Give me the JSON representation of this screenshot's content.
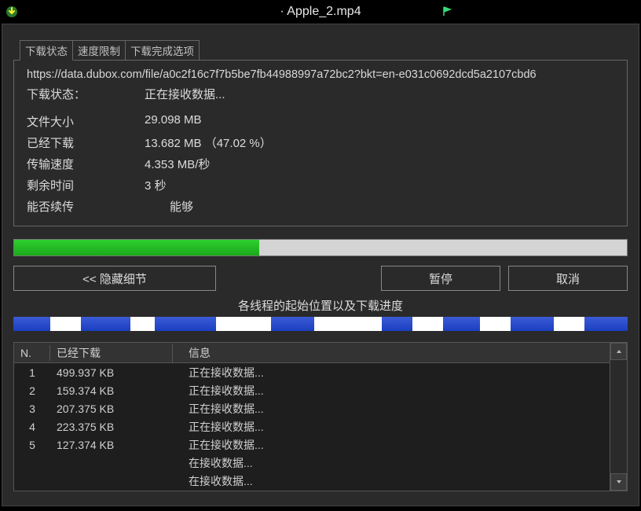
{
  "titlebar": {
    "title": "· Apple_2.mp4"
  },
  "tabs": {
    "status": "下载状态",
    "speed": "速度限制",
    "complete": "下载完成选项"
  },
  "status": {
    "url": "https://data.dubox.com/file/a0c2f16c7f7b5be7fb44988997a72bc2?bkt=en-e031c0692dcd5a2107cbd6",
    "label_state": "下载状态：",
    "value_state": "正在接收数据...",
    "label_size": "文件大小",
    "value_size": "29.098  MB",
    "label_downloaded": "已经下载",
    "value_downloaded": "13.682  MB （47.02 %）",
    "label_speed": "传输速度",
    "value_speed": "4.353  MB/秒",
    "label_remain": "剩余时间",
    "value_remain": "3 秒",
    "label_resume": "能否续传",
    "value_resume": "能够"
  },
  "progress": {
    "percent": 40
  },
  "buttons": {
    "hide": "<<  隐藏细节",
    "pause": "暂停",
    "cancel": "取消"
  },
  "threads": {
    "title": "各线程的起始位置以及下载进度",
    "header_n": "N.",
    "header_dl": "已经下载",
    "header_info": "信息",
    "rows": [
      {
        "n": "1",
        "dl": "499.937  KB",
        "info": "正在接收数据..."
      },
      {
        "n": "2",
        "dl": "159.374  KB",
        "info": "正在接收数据..."
      },
      {
        "n": "3",
        "dl": "207.375  KB",
        "info": "正在接收数据..."
      },
      {
        "n": "4",
        "dl": "223.375  KB",
        "info": "正在接收数据..."
      },
      {
        "n": "5",
        "dl": "127.374  KB",
        "info": "正在接收数据..."
      },
      {
        "n": "",
        "dl": "",
        "info": "在接收数据..."
      },
      {
        "n": "",
        "dl": "",
        "info": "在接收数据..."
      }
    ]
  }
}
